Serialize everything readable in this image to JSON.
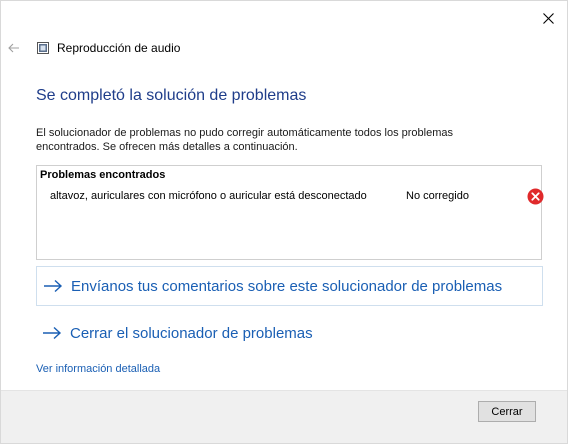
{
  "window": {
    "title": "Reproducción de audio",
    "icons": {
      "close": "close-icon",
      "back": "back-arrow-icon",
      "app": "troubleshooter-app-icon"
    }
  },
  "main": {
    "heading": "Se completó la solución de problemas",
    "description": "El solucionador de problemas no pudo corregir automáticamente todos los problemas encontrados. Se ofrecen más detalles a continuación.",
    "problems": {
      "title": "Problemas encontrados",
      "items": [
        {
          "description": "altavoz, auriculares con micrófono o auricular está desconectado",
          "status": "No corregido",
          "status_icon": "error-icon"
        }
      ]
    },
    "feedback_link": "Envíanos tus comentarios sobre este solucionador de problemas",
    "close_troubleshooter_link": "Cerrar el solucionador de problemas",
    "details_link": "Ver información detallada"
  },
  "footer": {
    "close_button": "Cerrar"
  },
  "colors": {
    "heading": "#1f3d8a",
    "link": "#1a5fb4",
    "error": "#e0292b",
    "footer_bg": "#f0f0f0"
  }
}
